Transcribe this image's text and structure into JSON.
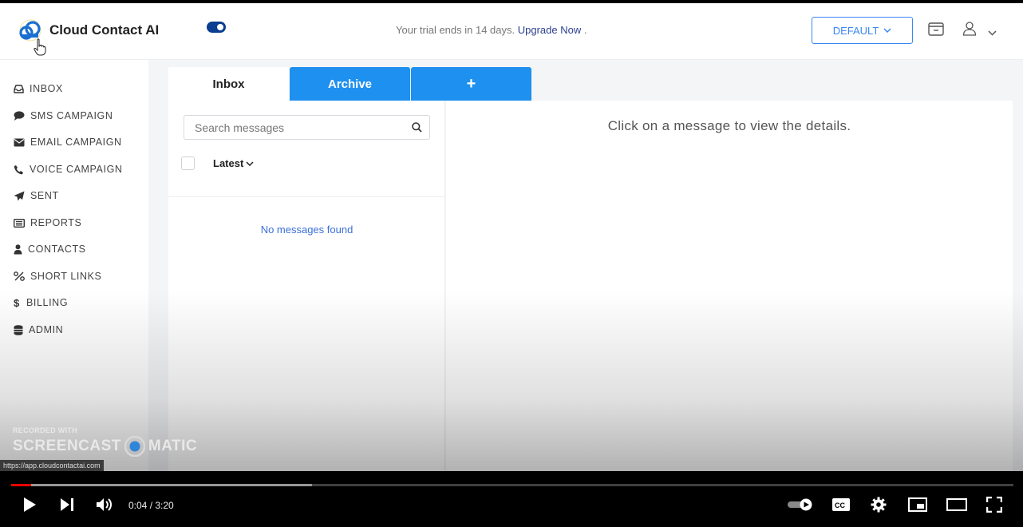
{
  "app": {
    "name": "Cloud Contact AI"
  },
  "header": {
    "trial_text": "Your trial ends in 14 days.",
    "upgrade_link": "Upgrade Now",
    "trial_suffix": ".",
    "profile_button": "DEFAULT",
    "toggle_on": true
  },
  "sidebar": {
    "items": [
      {
        "label": "INBOX",
        "icon": "inbox-icon"
      },
      {
        "label": "SMS CAMPAIGN",
        "icon": "chat-bubble-icon"
      },
      {
        "label": "EMAIL CAMPAIGN",
        "icon": "envelope-icon"
      },
      {
        "label": "VOICE CAMPAIGN",
        "icon": "phone-icon"
      },
      {
        "label": "SENT",
        "icon": "paper-plane-icon"
      },
      {
        "label": "REPORTS",
        "icon": "report-icon"
      },
      {
        "label": "CONTACTS",
        "icon": "user-icon"
      },
      {
        "label": "SHORT LINKS",
        "icon": "percent-link-icon"
      },
      {
        "label": "BILLING",
        "icon": "dollar-icon"
      },
      {
        "label": "ADMIN",
        "icon": "database-icon"
      }
    ]
  },
  "tabs": {
    "inbox": "Inbox",
    "archive": "Archive",
    "add": "+"
  },
  "list": {
    "search_placeholder": "Search messages",
    "sort_label": "Latest",
    "empty_text": "No messages found"
  },
  "detail": {
    "placeholder": "Click on a message to view the details."
  },
  "watermark": {
    "line1": "RECORDED WITH",
    "brand_left": "SCREENCAST",
    "brand_right": "MATIC"
  },
  "status_url": "https://app.cloudcontactai.com",
  "player": {
    "current_time": "0:04",
    "duration": "3:20",
    "time_text": "0:04 / 3:20",
    "played_fraction": 0.02,
    "buffered_fraction": 0.3
  },
  "colors": {
    "accent": "#1e90f0",
    "brand_dark": "#0b3d91",
    "link": "#3b6fd8",
    "progress_red": "#ff0000"
  }
}
